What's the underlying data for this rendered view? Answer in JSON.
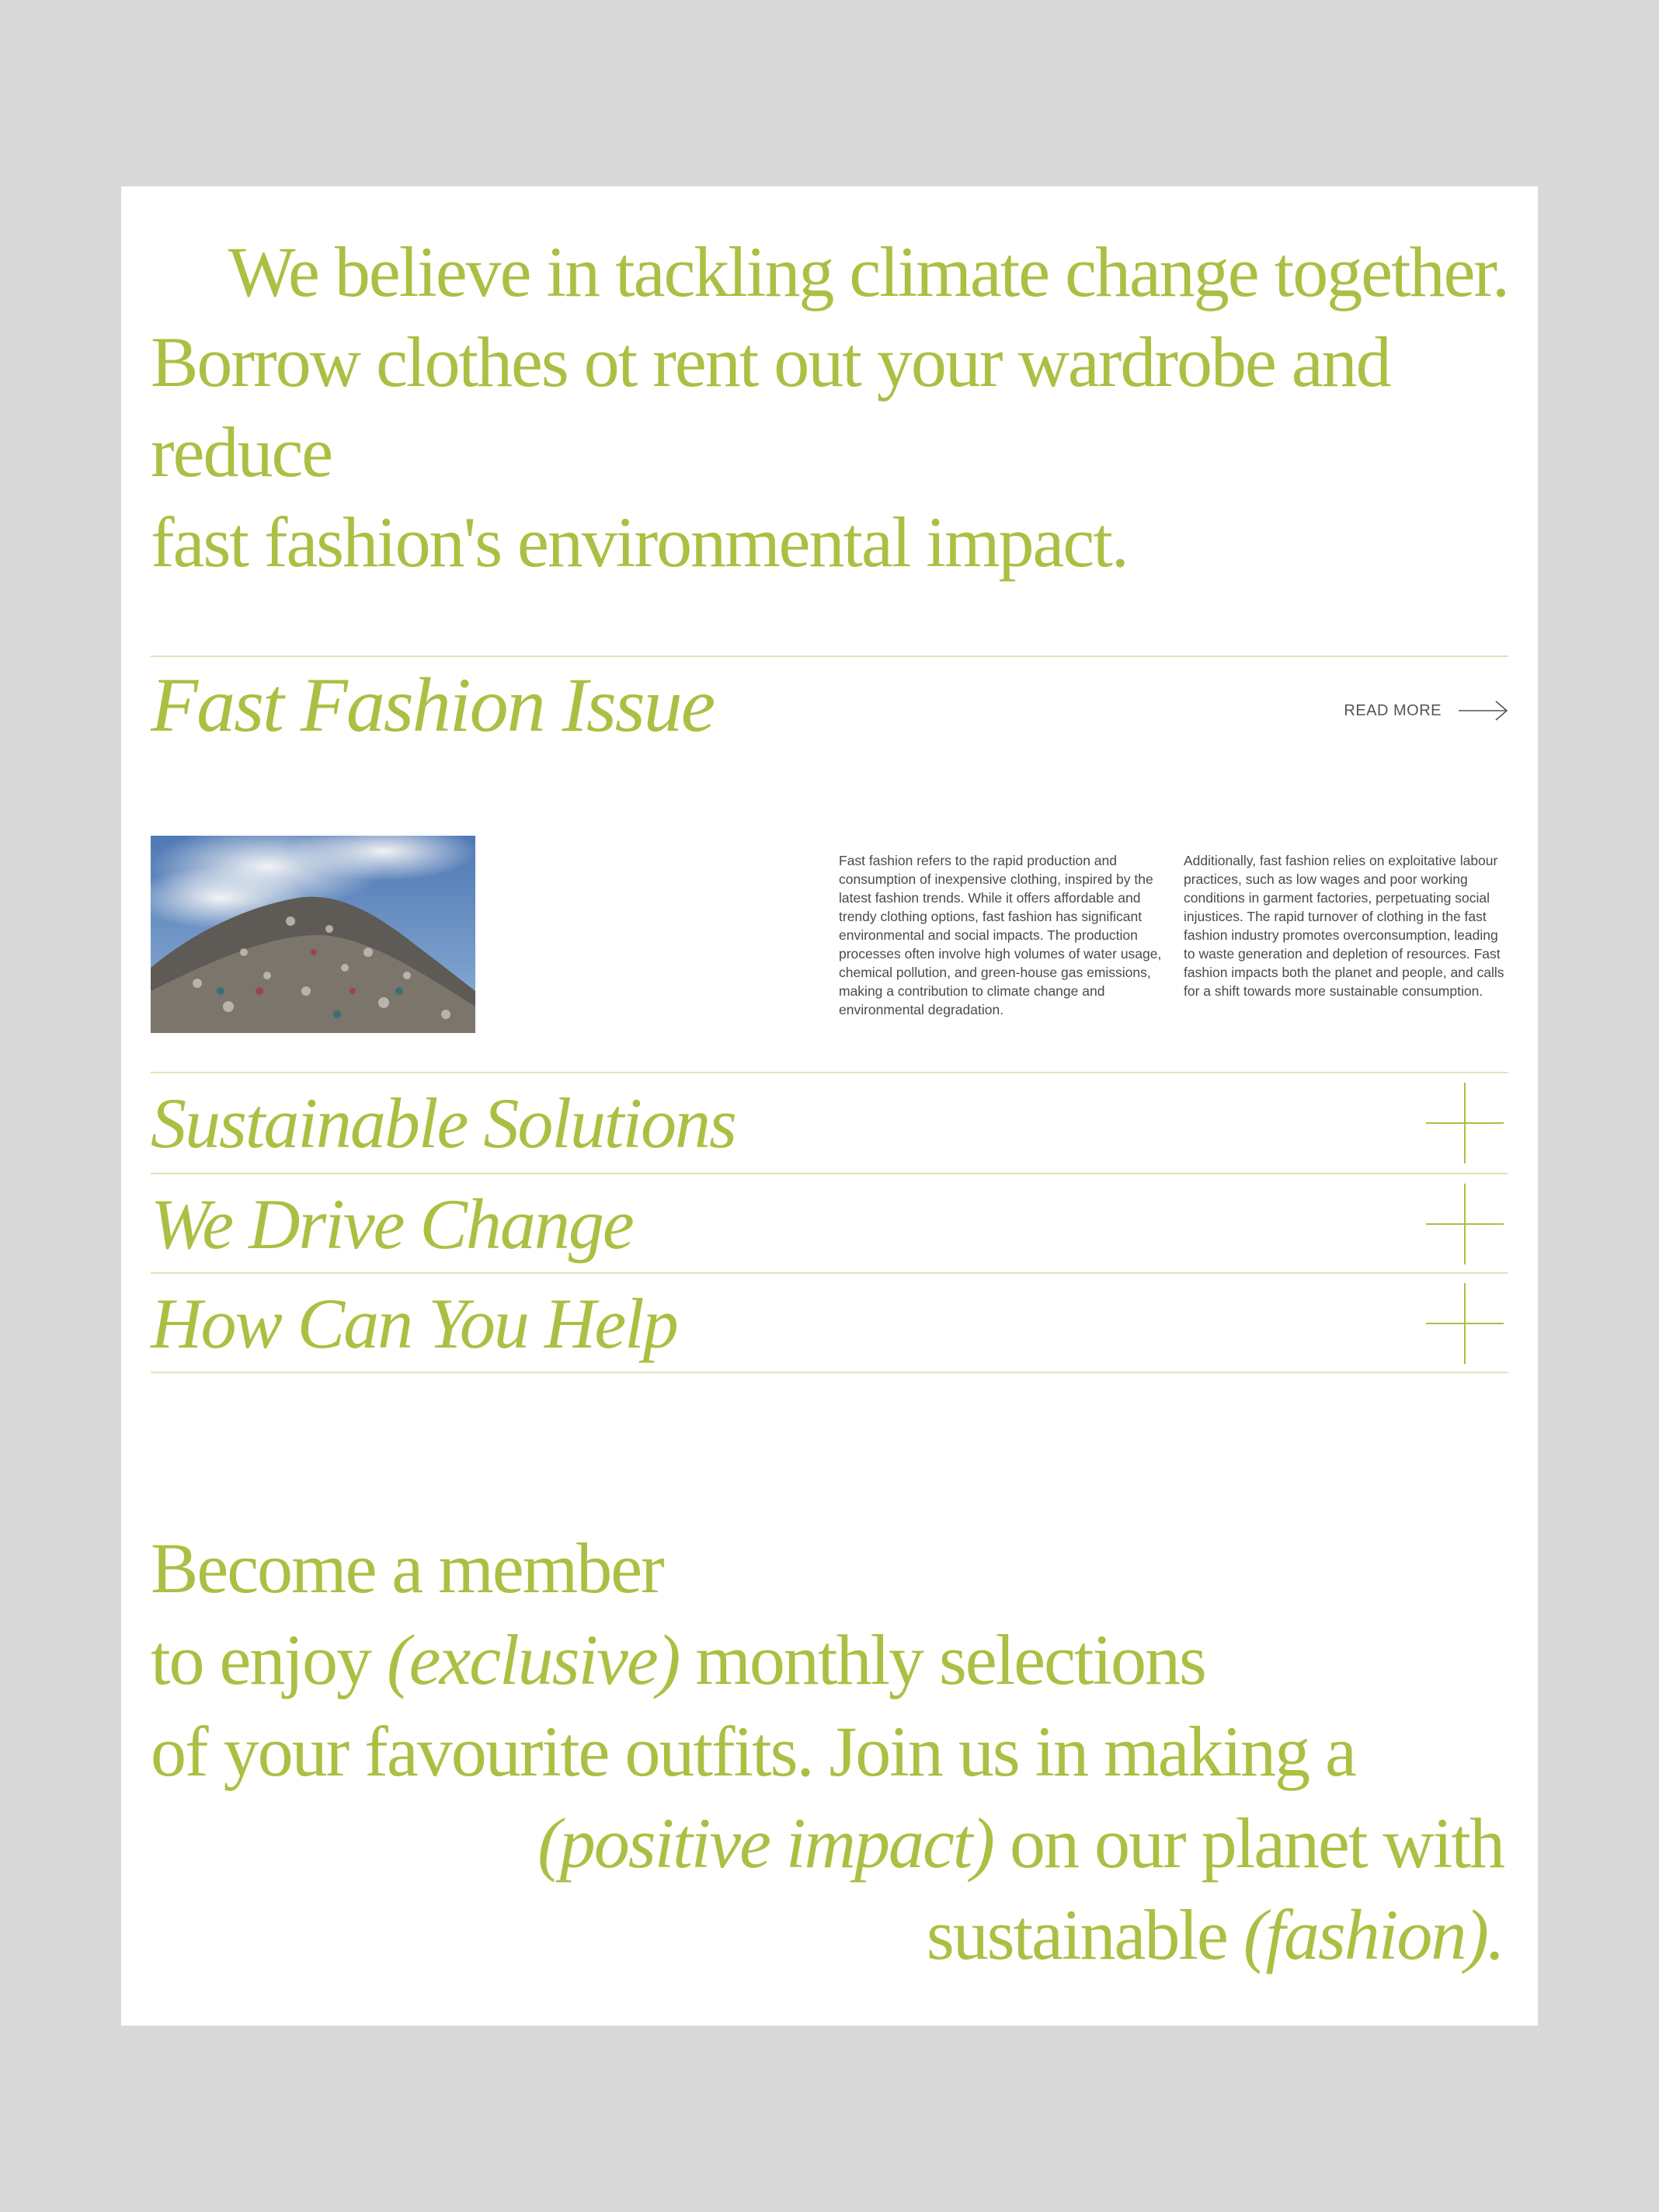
{
  "colors": {
    "accent": "#a9c043",
    "rule": "#dce6b4",
    "background": "#d9d9d9",
    "card": "#ffffff",
    "body_text": "#4a4a4a"
  },
  "intro": {
    "line1": "We believe in tackling climate change together.",
    "line2": "Borrow clothes ot rent out your wardrobe and reduce",
    "line3": "fast fashion's environmental impact."
  },
  "fashion_issue": {
    "title": "Fast Fashion Issue",
    "read_more": "READ MORE",
    "arrow_icon": "arrow-right-icon",
    "column1": "Fast fashion refers to the rapid production and consumption of inexpensive clothing, inspired by the latest fashion trends. While it offers affordable and trendy clothing options, fast fashion has significant environmental and social impacts. The production processes often involve high volumes of water usage, chemical pollution, and green-house gas emissions, making a contribution to climate change and environmental degradation.",
    "column2": "Additionally, fast fashion relies on exploitative labour practices, such as low wages and poor working conditions in garment factories, perpetuating social injustices.  The rapid turnover of clothing in the fast fashion industry promotes overconsumption, leading to waste generation and depletion of resources. Fast fashion impacts both the planet and people, and calls for a shift towards more sustainable consumption."
  },
  "accordion": [
    {
      "title": "Sustainable Solutions",
      "icon": "plus-icon"
    },
    {
      "title": "We Drive Change",
      "icon": "plus-icon"
    },
    {
      "title": "How Can You Help",
      "icon": "plus-icon"
    }
  ],
  "member": {
    "line1": "Become a member",
    "line2_a": "to enjoy ",
    "line2_em": "(exclusive)",
    "line2_b": " monthly selections",
    "line3": "of your favourite outfits. Join us in making a",
    "line4_em": "(positive impact)",
    "line4_b": " on our planet with",
    "line5_a": "sustainable ",
    "line5_em": "(fashion)."
  }
}
